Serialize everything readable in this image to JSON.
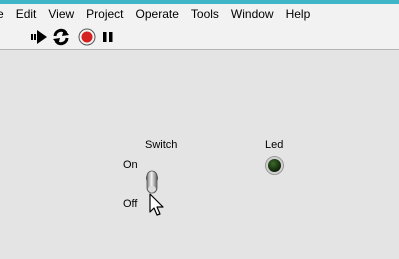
{
  "menubar": {
    "items": [
      "e",
      "Edit",
      "View",
      "Project",
      "Operate",
      "Tools",
      "Window",
      "Help"
    ]
  },
  "toolbar": {
    "buttons": [
      "run-arrow-icon",
      "run-continuously-icon",
      "abort-stop-icon",
      "pause-icon"
    ]
  },
  "front_panel": {
    "switch": {
      "label": "Switch",
      "on_text": "On",
      "off_text": "Off",
      "state": "off"
    },
    "led": {
      "label": "Led",
      "state": "off",
      "color_off": "#1d3a12"
    }
  },
  "colors": {
    "accent_strip": "#3fb6c8",
    "panel_background": "#e4e4e4",
    "stop_red": "#d42020"
  }
}
